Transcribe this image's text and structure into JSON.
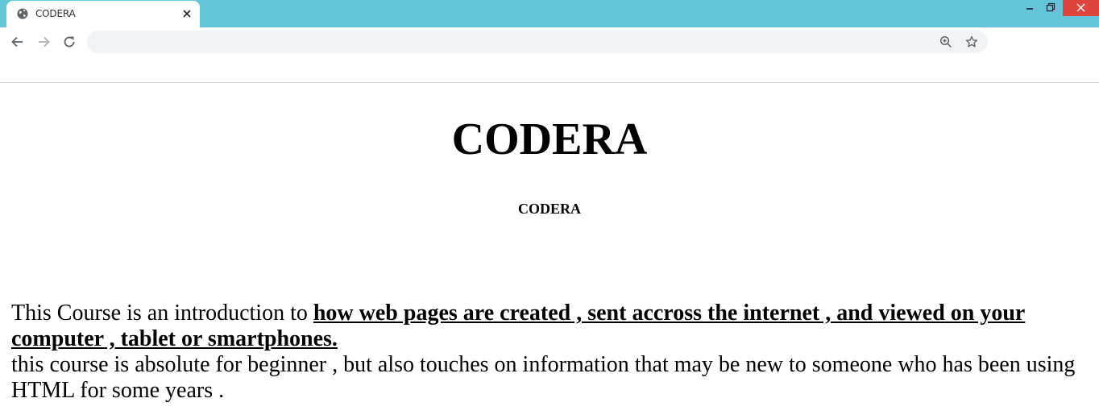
{
  "browser": {
    "tab": {
      "title": "CODERA",
      "icon": "globe-icon"
    },
    "tabstrip_color": "#63c5d9",
    "omnibox": {
      "value": "",
      "placeholder": ""
    },
    "toolbar_icons": [
      "back-arrow-icon",
      "forward-arrow-icon",
      "reload-icon",
      "zoom-icon",
      "star-icon"
    ],
    "window_controls": [
      "minimize-icon",
      "restore-icon",
      "close-icon"
    ]
  },
  "page": {
    "heading": "CODERA",
    "subheading": "CODERA",
    "intro_prefix": "This Course is an introduction to ",
    "intro_bold": "how web pages are created , sent accross the internet , and viewed on your computer , tablet or smartphones.",
    "intro_second": "this course is absolute for beginner , but also touches on information that may be new to someone who has been using HTML for some years ."
  }
}
